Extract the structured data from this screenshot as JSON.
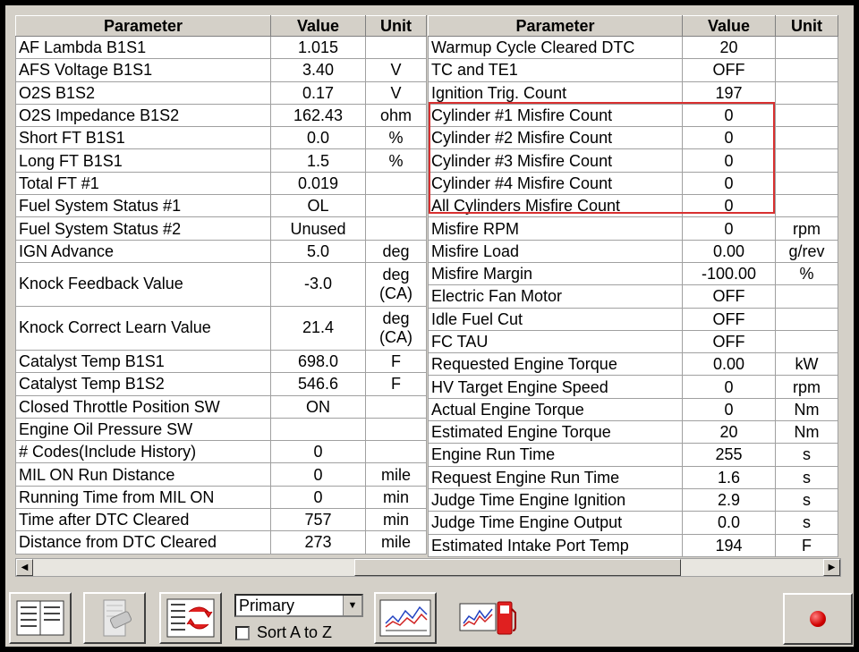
{
  "columns": {
    "parameter": "Parameter",
    "value": "Value",
    "unit": "Unit"
  },
  "left_rows": [
    {
      "param": "AF Lambda B1S1",
      "value": "1.015",
      "unit": ""
    },
    {
      "param": "AFS Voltage B1S1",
      "value": "3.40",
      "unit": "V"
    },
    {
      "param": "O2S B1S2",
      "value": "0.17",
      "unit": "V"
    },
    {
      "param": "O2S Impedance B1S2",
      "value": "162.43",
      "unit": "ohm"
    },
    {
      "param": "Short FT B1S1",
      "value": "0.0",
      "unit": "%"
    },
    {
      "param": "Long FT B1S1",
      "value": "1.5",
      "unit": "%"
    },
    {
      "param": "Total FT #1",
      "value": "0.019",
      "unit": ""
    },
    {
      "param": "Fuel System Status #1",
      "value": "OL",
      "unit": ""
    },
    {
      "param": "Fuel System Status #2",
      "value": "Unused",
      "unit": ""
    },
    {
      "param": "IGN Advance",
      "value": "5.0",
      "unit": "deg"
    },
    {
      "param": "Knock Feedback Value",
      "value": "-3.0",
      "unit": "deg (CA)"
    },
    {
      "param": "Knock Correct Learn Value",
      "value": "21.4",
      "unit": "deg (CA)"
    },
    {
      "param": "Catalyst Temp B1S1",
      "value": "698.0",
      "unit": "F"
    },
    {
      "param": "Catalyst Temp B1S2",
      "value": "546.6",
      "unit": "F"
    },
    {
      "param": "Closed Throttle Position SW",
      "value": "ON",
      "unit": ""
    },
    {
      "param": "Engine Oil Pressure SW",
      "value": "",
      "unit": ""
    },
    {
      "param": "# Codes(Include History)",
      "value": "0",
      "unit": ""
    },
    {
      "param": "MIL ON Run Distance",
      "value": "0",
      "unit": "mile"
    },
    {
      "param": "Running Time from MIL ON",
      "value": "0",
      "unit": "min"
    },
    {
      "param": "Time after DTC Cleared",
      "value": "757",
      "unit": "min"
    },
    {
      "param": "Distance from DTC Cleared",
      "value": "273",
      "unit": "mile"
    }
  ],
  "right_rows": [
    {
      "param": "Warmup Cycle Cleared DTC",
      "value": "20",
      "unit": ""
    },
    {
      "param": "TC and TE1",
      "value": "OFF",
      "unit": ""
    },
    {
      "param": "Ignition Trig. Count",
      "value": "197",
      "unit": ""
    },
    {
      "param": "Cylinder #1 Misfire Count",
      "value": "0",
      "unit": ""
    },
    {
      "param": "Cylinder #2 Misfire Count",
      "value": "0",
      "unit": ""
    },
    {
      "param": "Cylinder #3 Misfire Count",
      "value": "0",
      "unit": ""
    },
    {
      "param": "Cylinder #4 Misfire Count",
      "value": "0",
      "unit": ""
    },
    {
      "param": "All Cylinders Misfire Count",
      "value": "0",
      "unit": ""
    },
    {
      "param": "Misfire RPM",
      "value": "0",
      "unit": "rpm"
    },
    {
      "param": "Misfire Load",
      "value": "0.00",
      "unit": "g/rev"
    },
    {
      "param": "Misfire Margin",
      "value": "-100.00",
      "unit": "%"
    },
    {
      "param": "Electric Fan Motor",
      "value": "OFF",
      "unit": ""
    },
    {
      "param": "Idle Fuel Cut",
      "value": "OFF",
      "unit": ""
    },
    {
      "param": "FC TAU",
      "value": "OFF",
      "unit": ""
    },
    {
      "param": "Requested Engine Torque",
      "value": "0.00",
      "unit": "kW"
    },
    {
      "param": "HV Target Engine Speed",
      "value": "0",
      "unit": "rpm"
    },
    {
      "param": "Actual Engine Torque",
      "value": "0",
      "unit": "Nm"
    },
    {
      "param": "Estimated Engine Torque",
      "value": "20",
      "unit": "Nm"
    },
    {
      "param": "Engine Run Time",
      "value": "255",
      "unit": "s"
    },
    {
      "param": "Request Engine Run Time",
      "value": "1.6",
      "unit": "s"
    },
    {
      "param": "Judge Time Engine Ignition",
      "value": "2.9",
      "unit": "s"
    },
    {
      "param": "Judge Time Engine Output",
      "value": "0.0",
      "unit": "s"
    },
    {
      "param": "Estimated Intake Port Temp",
      "value": "194",
      "unit": "F"
    }
  ],
  "toolbar": {
    "select_value": "Primary",
    "sort_label": "Sort A to Z",
    "sort_checked": false
  },
  "icons": {
    "list": "list-view-icon",
    "part": "component-icon",
    "refresh": "refresh-list-icon",
    "graph": "line-graph-icon",
    "fuel": "graph-fuel-icon",
    "record": "record-icon"
  },
  "colors": {
    "highlight": "#d83030",
    "record": "#d00000"
  }
}
